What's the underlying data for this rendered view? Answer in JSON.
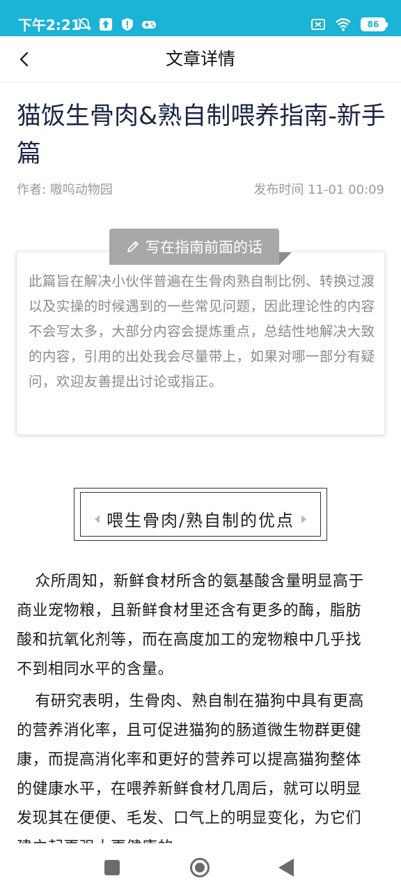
{
  "status_bar": {
    "time": "下午2:21",
    "battery": "86",
    "icons_left": [
      "mute-icon",
      "upload-icon",
      "shield-icon",
      "gamepad-icon"
    ],
    "icons_right": [
      "sim-off-icon",
      "wifi-icon",
      "battery-icon"
    ],
    "bg_color": "#1bb3d6"
  },
  "nav": {
    "title": "文章详情",
    "back_icon": "chevron-left-icon"
  },
  "article": {
    "title": "猫饭生骨肉&熟自制喂养指南-新手篇",
    "author": "作者: 嗷呜动物园",
    "publish_time": "发布时间 11-01 00:09"
  },
  "preface": {
    "tab_label": "写在指南前面的话",
    "tab_icon": "pencil-icon",
    "text": "此篇旨在解决小伙伴普遍在生骨肉熟自制比例、转换过渡以及实操的时候遇到的一些常见问题，因此理论性的内容不会写太多，大部分内容会提炼重点，总结性地解决大致的内容，引用的出处我会尽量带上，如果对哪一部分有疑问，欢迎友善提出讨论或指正。"
  },
  "section": {
    "heading": "喂生骨肉/熟自制的优点"
  },
  "body": {
    "paragraphs": [
      "众所周知，新鲜食材所含的氨基酸含量明显高于商业宠物粮，且新鲜食材里还含有更多的酶，脂肪酸和抗氧化剂等，而在高度加工的宠物粮中几乎找不到相同水平的含量。",
      "有研究表明，生骨肉、熟自制在猫狗中具有更高的营养消化率，且可促进猫狗的肠道微生物群更健康，而提高消化率和更好的营养可以提高猫狗整体的健康水平，在喂养新鲜食材几周后，就可以明显发现其在便便、毛发、口气上的明显变化，为它们建立起更强大更健康的"
    ]
  },
  "system_nav": {
    "icons": [
      "recent-apps-icon",
      "home-icon",
      "back-icon"
    ]
  }
}
